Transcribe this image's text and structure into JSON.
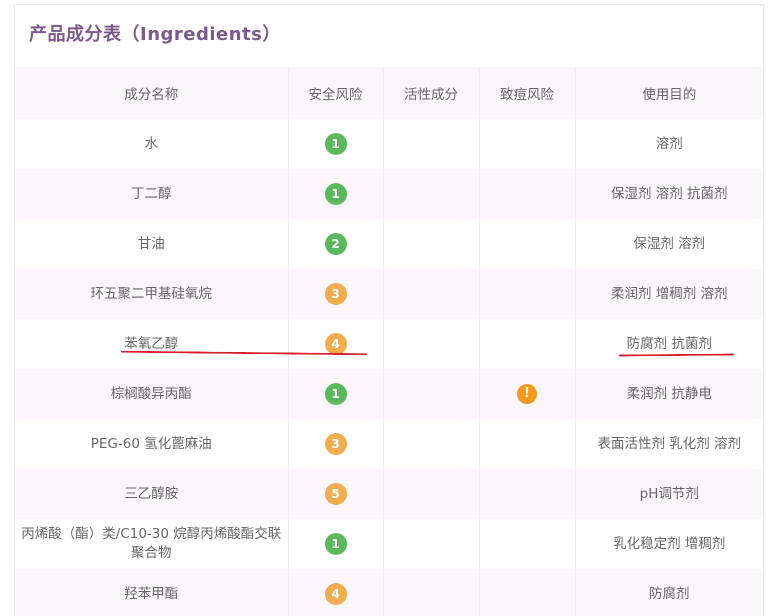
{
  "title": "产品成分表（Ingredients）",
  "headers": [
    "成分名称",
    "安全风险",
    "活性成分",
    "致痘风险",
    "使用目的"
  ],
  "colors": {
    "low_risk": "#5cb85c",
    "mid_risk": "#f0ad4e",
    "acne_warning": "#f39a1e",
    "annotation_line": "#d81e2a"
  },
  "rows": [
    {
      "name": "水",
      "risk": "1",
      "risk_color": "#5cb85c",
      "active": "",
      "acne": "",
      "purpose": "溶剂"
    },
    {
      "name": "丁二醇",
      "risk": "1",
      "risk_color": "#5cb85c",
      "active": "",
      "acne": "",
      "purpose": "保湿剂 溶剂 抗菌剂"
    },
    {
      "name": "甘油",
      "risk": "2",
      "risk_color": "#5cb85c",
      "active": "",
      "acne": "",
      "purpose": "保湿剂 溶剂"
    },
    {
      "name": "环五聚二甲基硅氧烷",
      "risk": "3",
      "risk_color": "#f0ad4e",
      "active": "",
      "acne": "",
      "purpose": "柔润剂 增稠剂 溶剂"
    },
    {
      "name": "苯氧乙醇",
      "risk": "4",
      "risk_color": "#f0ad4e",
      "active": "",
      "acne": "",
      "purpose": "防腐剂 抗菌剂"
    },
    {
      "name": "棕榈酸异丙酯",
      "risk": "1",
      "risk_color": "#5cb85c",
      "active": "",
      "acne": "!",
      "purpose": "柔润剂 抗静电"
    },
    {
      "name": "PEG-60 氢化蓖麻油",
      "risk": "3",
      "risk_color": "#f0ad4e",
      "active": "",
      "acne": "",
      "purpose": "表面活性剂 乳化剂 溶剂"
    },
    {
      "name": "三乙醇胺",
      "risk": "5",
      "risk_color": "#f0ad4e",
      "active": "",
      "acne": "",
      "purpose": "pH调节剂"
    },
    {
      "name": "丙烯酸（酯）类/C10-30 烷醇丙烯酸酯交联聚合物",
      "risk": "1",
      "risk_color": "#5cb85c",
      "active": "",
      "acne": "",
      "purpose": "乳化稳定剂 增稠剂"
    },
    {
      "name": "羟苯甲酯",
      "risk": "4",
      "risk_color": "#f0ad4e",
      "active": "",
      "acne": "",
      "purpose": "防腐剂"
    }
  ]
}
